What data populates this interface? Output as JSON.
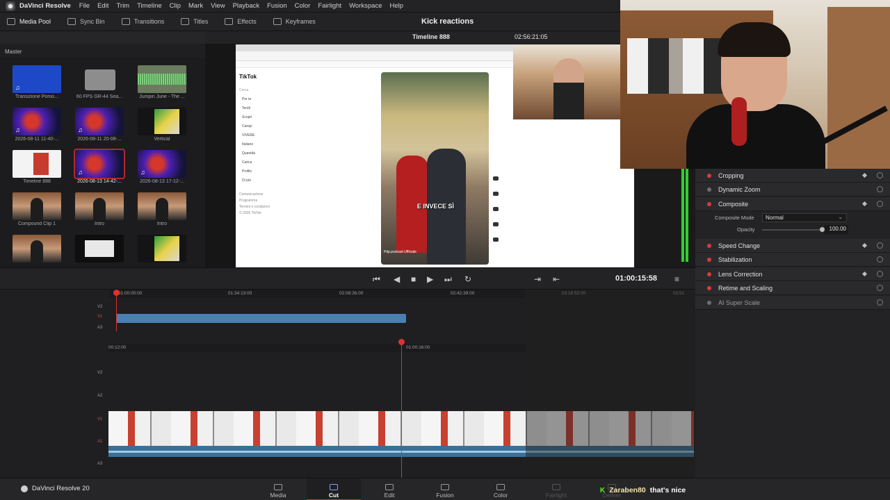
{
  "app": {
    "name": "DaVinci Resolve",
    "project_title": "Kick reactions",
    "version_label": "DaVinci Resolve 20"
  },
  "menu": [
    "File",
    "Edit",
    "Trim",
    "Timeline",
    "Clip",
    "Mark",
    "View",
    "Playback",
    "Fusion",
    "Color",
    "Fairlight",
    "Workspace",
    "Help"
  ],
  "toolbar": [
    "Media Pool",
    "Sync Bin",
    "Transitions",
    "Titles",
    "Effects",
    "Keyframes"
  ],
  "media_pool": {
    "header": "Master",
    "clips": [
      {
        "label": "Transizione Pomo...",
        "kind": "t-blue",
        "audio": true
      },
      {
        "label": "60 FPS GR-44 Sea...",
        "kind": "t-folder",
        "audio": false
      },
      {
        "label": "Jumpin June - The ...",
        "kind": "t-wave",
        "audio": false
      },
      {
        "label": "2026-08-11 11-40-...",
        "kind": "t-fx",
        "audio": true
      },
      {
        "label": "2026-08-11 20-08-...",
        "kind": "t-fx",
        "audio": true
      },
      {
        "label": "Vertical",
        "kind": "t-vert",
        "audio": false
      },
      {
        "label": "Timeline 888",
        "kind": "t-tiktok",
        "audio": false
      },
      {
        "label": "2026-08-13 14-42-...",
        "kind": "t-fx",
        "audio": true,
        "selected": true
      },
      {
        "label": "2026-08-13 17-12-...",
        "kind": "t-fx",
        "audio": true
      },
      {
        "label": "Compound Clip 1",
        "kind": "t-room",
        "audio": false
      },
      {
        "label": "Intro",
        "kind": "t-room",
        "audio": false
      },
      {
        "label": "Intro",
        "kind": "t-room",
        "audio": false
      },
      {
        "label": "",
        "kind": "t-room",
        "audio": false
      },
      {
        "label": "",
        "kind": "t-dark",
        "audio": false
      },
      {
        "label": "",
        "kind": "t-vert",
        "audio": false
      }
    ]
  },
  "viewer": {
    "timeline_name": "Timeline 888",
    "duration": "02:56:21:05",
    "tiktok": {
      "logo": "TikTok",
      "search": "Cerca",
      "nav": [
        "Per te",
        "Tendi",
        "Scopri",
        "Campi",
        "VIVERE",
        "Italiano",
        "Quantità",
        "Carica",
        "Profilo",
        "Di più"
      ],
      "footer": [
        "Comunicazione",
        "Programma",
        "Termini e condizioni",
        "© 2026 TikTok"
      ],
      "caption": "E INVECE SÌ",
      "user": "Pdp.podcast Ufficiale"
    }
  },
  "inspector": {
    "sections": [
      {
        "name": "Cropping",
        "enabled": true,
        "dim": false
      },
      {
        "name": "Dynamic Zoom",
        "enabled": false,
        "dim": false
      },
      {
        "name": "Composite",
        "enabled": true,
        "dim": false
      },
      {
        "name": "Speed Change",
        "enabled": true,
        "dim": false
      },
      {
        "name": "Stabilization",
        "enabled": true,
        "dim": false
      },
      {
        "name": "Lens Correction",
        "enabled": true,
        "dim": false
      },
      {
        "name": "Retime and Scaling",
        "enabled": true,
        "dim": false
      },
      {
        "name": "AI Super Scale",
        "enabled": false,
        "dim": true
      }
    ],
    "composite_mode_label": "Composite Mode",
    "composite_mode_value": "Normal",
    "opacity_label": "Opacity",
    "opacity_value": "100.00"
  },
  "transport": {
    "timecode": "01:00:15:58"
  },
  "timeline": {
    "upper_ruler": [
      "01:00:00:00",
      "01:34:13:00",
      "02:08:26:00",
      "02:42:39:00",
      "03:16:52:00",
      "03:51"
    ],
    "lower_ruler": [
      "00:12:00",
      "01:00:16:00"
    ],
    "upper_tracks": [
      "V2",
      "V1",
      "A3"
    ],
    "lower_tracks": [
      "V2",
      "A2",
      "V1",
      "A1",
      "A3"
    ]
  },
  "pages": [
    {
      "label": "Media",
      "active": false,
      "ghost": false
    },
    {
      "label": "Cut",
      "active": true,
      "ghost": false
    },
    {
      "label": "Edit",
      "active": false,
      "ghost": false
    },
    {
      "label": "Fusion",
      "active": false,
      "ghost": false
    },
    {
      "label": "Color",
      "active": false,
      "ghost": false
    },
    {
      "label": "Fairlight",
      "active": false,
      "ghost": true
    },
    {
      "label": "Deliver",
      "active": false,
      "ghost": true
    }
  ],
  "chat": {
    "user": "Zaraben80",
    "message": "that's nice"
  }
}
